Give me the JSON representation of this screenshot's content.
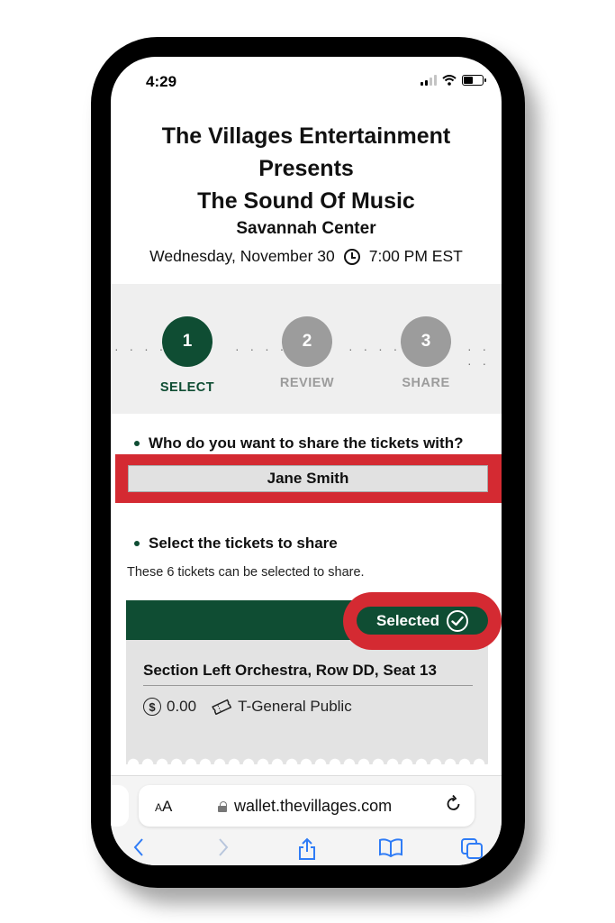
{
  "status_bar": {
    "time": "4:29"
  },
  "event": {
    "title_line1": "The Villages Entertainment",
    "title_line2": "Presents",
    "title_line3": "The Sound Of Music",
    "venue": "Savannah Center",
    "date": "Wednesday, November 30",
    "time": "7:00 PM EST"
  },
  "stepper": {
    "steps": [
      {
        "number": "1",
        "label": "SELECT",
        "state": "active"
      },
      {
        "number": "2",
        "label": "REVIEW",
        "state": "inactive"
      },
      {
        "number": "3",
        "label": "SHARE",
        "state": "inactive"
      }
    ],
    "separator": "· · · ·"
  },
  "share": {
    "question": "Who do you want to share the tickets with?",
    "recipient": "Jane Smith"
  },
  "tickets_section": {
    "heading": "Select the tickets to share",
    "note": "These 6 tickets can be selected to share."
  },
  "ticket": {
    "selected_label": "Selected",
    "seat": "Section Left Orchestra, Row DD, Seat 13",
    "price": "0.00",
    "price_type": "T-General Public"
  },
  "browser": {
    "text_size_label_small": "A",
    "text_size_label_large": "A",
    "url": "wallet.thevillages.com"
  },
  "colors": {
    "brand_green": "#0f4d33",
    "highlight_red": "#d42a32",
    "ios_blue": "#2f7cf6"
  },
  "icons": [
    "signal-icon",
    "wifi-icon",
    "battery-icon",
    "clock-icon",
    "check-circle-icon",
    "dollar-circle-icon",
    "ticket-icon",
    "lock-icon",
    "reload-icon",
    "back-icon",
    "forward-icon",
    "share-icon",
    "bookmarks-icon",
    "tabs-icon"
  ]
}
